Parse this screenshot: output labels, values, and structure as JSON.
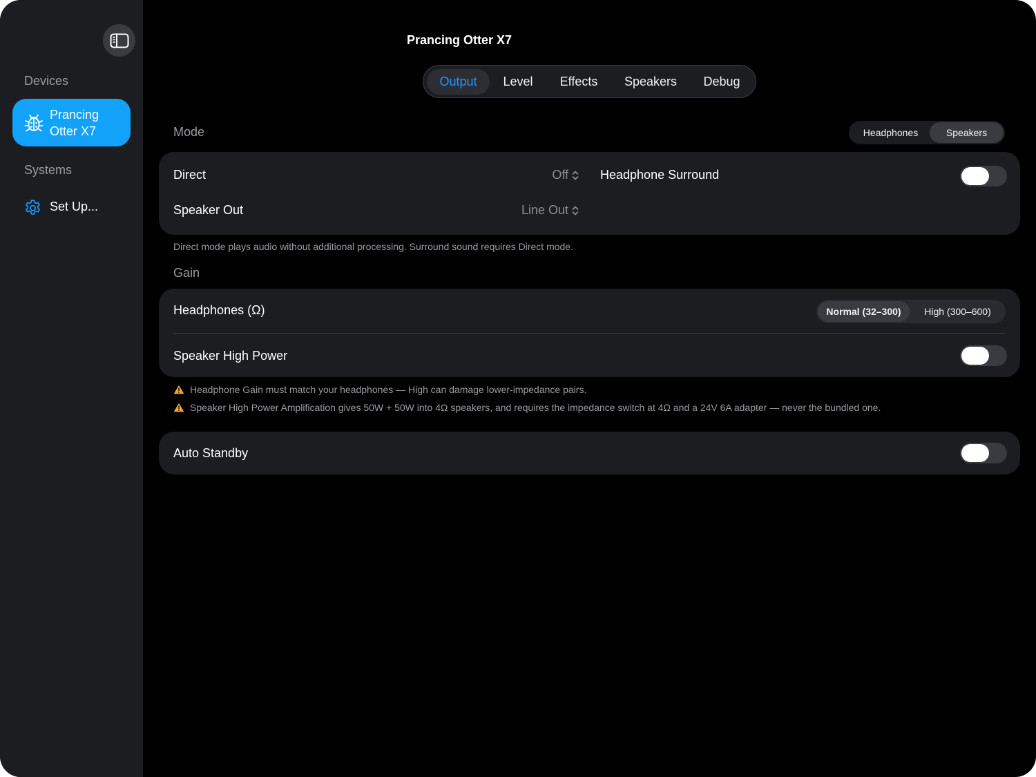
{
  "sidebar": {
    "toggle_icon": "sidebar-left-icon",
    "devices_header": "Devices",
    "device_item": {
      "label": "Prancing Otter X7",
      "icon": "ladybug-icon",
      "color": "#12a2f9"
    },
    "systems_header": "Systems",
    "setup_item": {
      "label": "Set Up...",
      "icon": "gear-icon",
      "color": "#1a9aff"
    }
  },
  "header": {
    "title": "Prancing Otter X7",
    "tabs": [
      {
        "label": "Output",
        "active": true
      },
      {
        "label": "Level",
        "active": false
      },
      {
        "label": "Effects",
        "active": false
      },
      {
        "label": "Speakers",
        "active": false
      },
      {
        "label": "Debug",
        "active": false
      }
    ]
  },
  "mode": {
    "section_label": "Mode",
    "segment": {
      "options": [
        "Headphones",
        "Speakers"
      ],
      "selected": "Speakers"
    },
    "direct": {
      "label": "Direct",
      "value": "Off"
    },
    "speaker_out": {
      "label": "Speaker Out",
      "value": "Line Out"
    },
    "headphone_surround": {
      "label": "Headphone Surround",
      "on": false
    },
    "footnote": "Direct mode plays audio without additional processing. Surround sound requires Direct mode."
  },
  "gain": {
    "section_label": "Gain",
    "headphones": {
      "label": "Headphones (Ω)",
      "options": [
        "Normal (32–300)",
        "High (300–600)"
      ],
      "selected": "Normal (32–300)"
    },
    "speaker_high_power": {
      "label": "Speaker High Power",
      "on": false
    },
    "warnings": [
      "Headphone Gain must match your headphones — High can damage lower-impedance pairs.",
      "Speaker High Power Amplification gives 50W + 50W into 4Ω speakers, and requires the impedance switch at 4Ω and a 24V 6A adapter — never the bundled one."
    ],
    "warning_color": "#f5a623"
  },
  "standby": {
    "label": "Auto Standby",
    "on": false
  }
}
